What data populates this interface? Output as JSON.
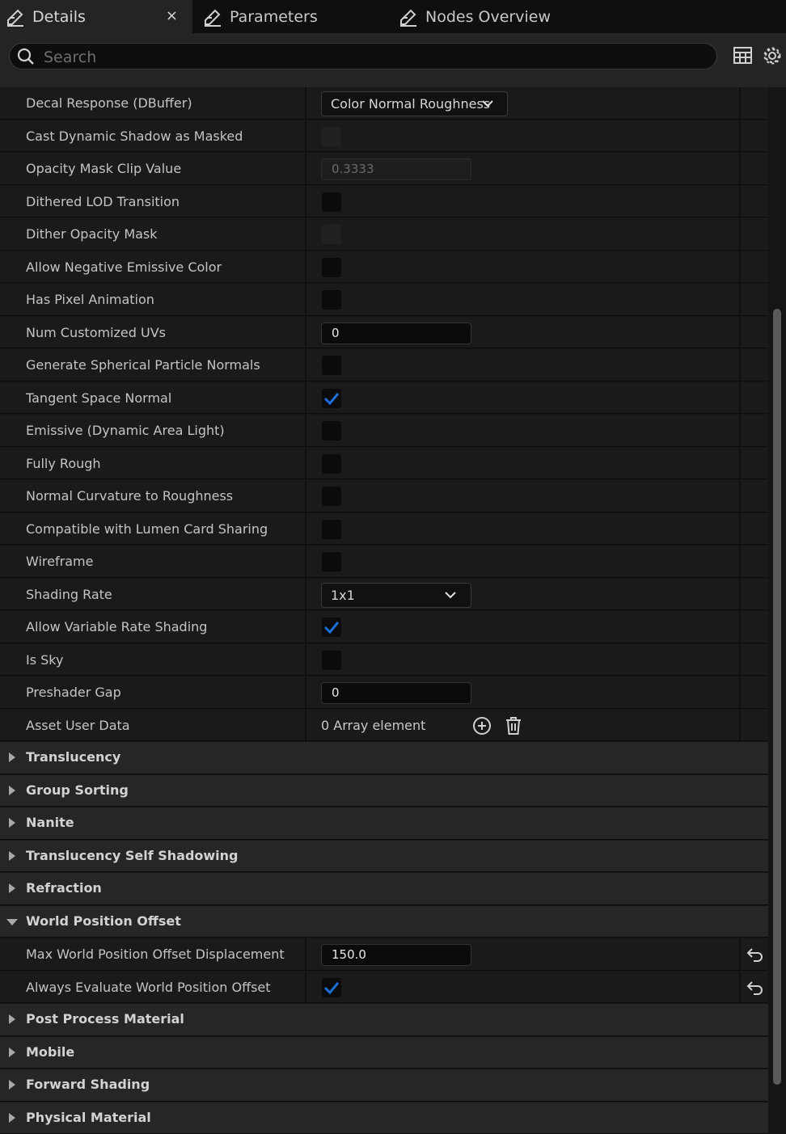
{
  "tabs": [
    {
      "label": "Details",
      "icon": "edit-icon",
      "active": true,
      "close": "×"
    },
    {
      "label": "Parameters",
      "icon": "edit-icon",
      "active": false
    },
    {
      "label": "Nodes Overview",
      "icon": "edit-icon",
      "active": false
    }
  ],
  "search": {
    "placeholder": "Search",
    "value": ""
  },
  "toolbar": {
    "table_icon": "table-view-icon",
    "settings_icon": "gear-icon"
  },
  "properties": {
    "decal_response": {
      "label": "Decal Response (DBuffer)",
      "value": "Color Normal Roughness"
    },
    "cast_dynamic_shadow": {
      "label": "Cast Dynamic Shadow as Masked",
      "checked": false,
      "enabled": false
    },
    "opacity_mask_clip": {
      "label": "Opacity Mask Clip Value",
      "value": "0.3333",
      "enabled": false
    },
    "dithered_lod": {
      "label": "Dithered LOD Transition",
      "checked": false
    },
    "dither_opacity_mask": {
      "label": "Dither Opacity Mask",
      "checked": false,
      "enabled": false
    },
    "allow_negative_emissive": {
      "label": "Allow Negative Emissive Color",
      "checked": false
    },
    "has_pixel_animation": {
      "label": "Has Pixel Animation",
      "checked": false
    },
    "num_customized_uvs": {
      "label": "Num Customized UVs",
      "value": "0"
    },
    "generate_spherical": {
      "label": "Generate Spherical Particle Normals",
      "checked": false
    },
    "tangent_space_normal": {
      "label": "Tangent Space Normal",
      "checked": true
    },
    "emissive_dynamic": {
      "label": "Emissive (Dynamic Area Light)",
      "checked": false
    },
    "fully_rough": {
      "label": "Fully Rough",
      "checked": false
    },
    "normal_curvature": {
      "label": "Normal Curvature to Roughness",
      "checked": false
    },
    "lumen_card_sharing": {
      "label": "Compatible with Lumen Card Sharing",
      "checked": false
    },
    "wireframe": {
      "label": "Wireframe",
      "checked": false
    },
    "shading_rate": {
      "label": "Shading Rate",
      "value": "1x1"
    },
    "allow_vrs": {
      "label": "Allow Variable Rate Shading",
      "checked": true
    },
    "is_sky": {
      "label": "Is Sky",
      "checked": false
    },
    "preshader_gap": {
      "label": "Preshader Gap",
      "value": "0"
    },
    "asset_user_data": {
      "label": "Asset User Data",
      "value": "0 Array element"
    }
  },
  "categories": {
    "translucency": "Translucency",
    "group_sorting": "Group Sorting",
    "nanite": "Nanite",
    "translucency_self_shadowing": "Translucency Self Shadowing",
    "refraction": "Refraction",
    "world_position_offset": "World Position Offset",
    "post_process_material": "Post Process Material",
    "mobile": "Mobile",
    "forward_shading": "Forward Shading",
    "physical_material": "Physical Material"
  },
  "wpo": {
    "max_displacement": {
      "label": "Max World Position Offset Displacement",
      "value": "150.0"
    },
    "always_evaluate": {
      "label": "Always Evaluate World Position Offset",
      "checked": true
    }
  },
  "colors": {
    "accent": "#1a6fd8",
    "panel": "#1a1a1a",
    "category": "#262626"
  }
}
